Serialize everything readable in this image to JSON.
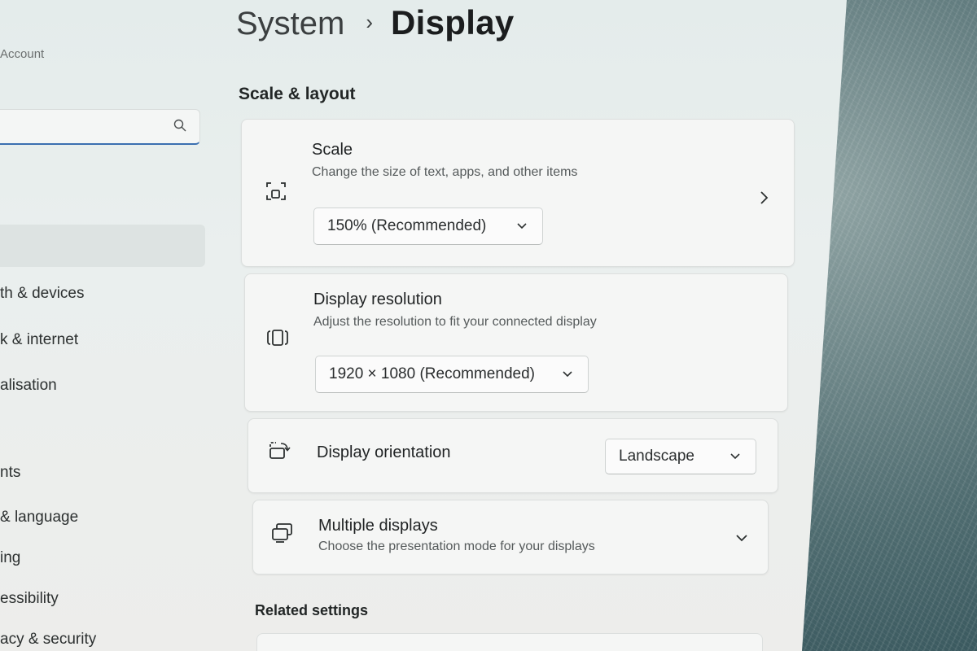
{
  "sidebar": {
    "account_label": "Account",
    "search": {
      "placeholder": ""
    },
    "items": [
      {
        "label": "th & devices"
      },
      {
        "label": "k & internet"
      },
      {
        "label": "alisation"
      },
      {
        "label": "nts"
      },
      {
        "label": "& language"
      },
      {
        "label": "ing"
      },
      {
        "label": "essibility"
      },
      {
        "label": "acy & security"
      }
    ]
  },
  "header": {
    "parent": "System",
    "separator": "›",
    "current": "Display"
  },
  "section_title": "Scale & layout",
  "cards": {
    "scale": {
      "title": "Scale",
      "subtitle": "Change the size of text, apps, and other items",
      "value": "150% (Recommended)",
      "icon": "scale-icon"
    },
    "resolution": {
      "title": "Display resolution",
      "subtitle": "Adjust the resolution to fit your connected display",
      "value": "1920 × 1080 (Recommended)",
      "icon": "resolution-icon"
    },
    "orientation": {
      "title": "Display orientation",
      "value": "Landscape",
      "icon": "orientation-icon"
    },
    "multiple": {
      "title": "Multiple displays",
      "subtitle": "Choose the presentation mode for your displays",
      "icon": "multiple-displays-icon"
    }
  },
  "related_title": "Related settings",
  "colors": {
    "accent": "#3a6fb0"
  }
}
